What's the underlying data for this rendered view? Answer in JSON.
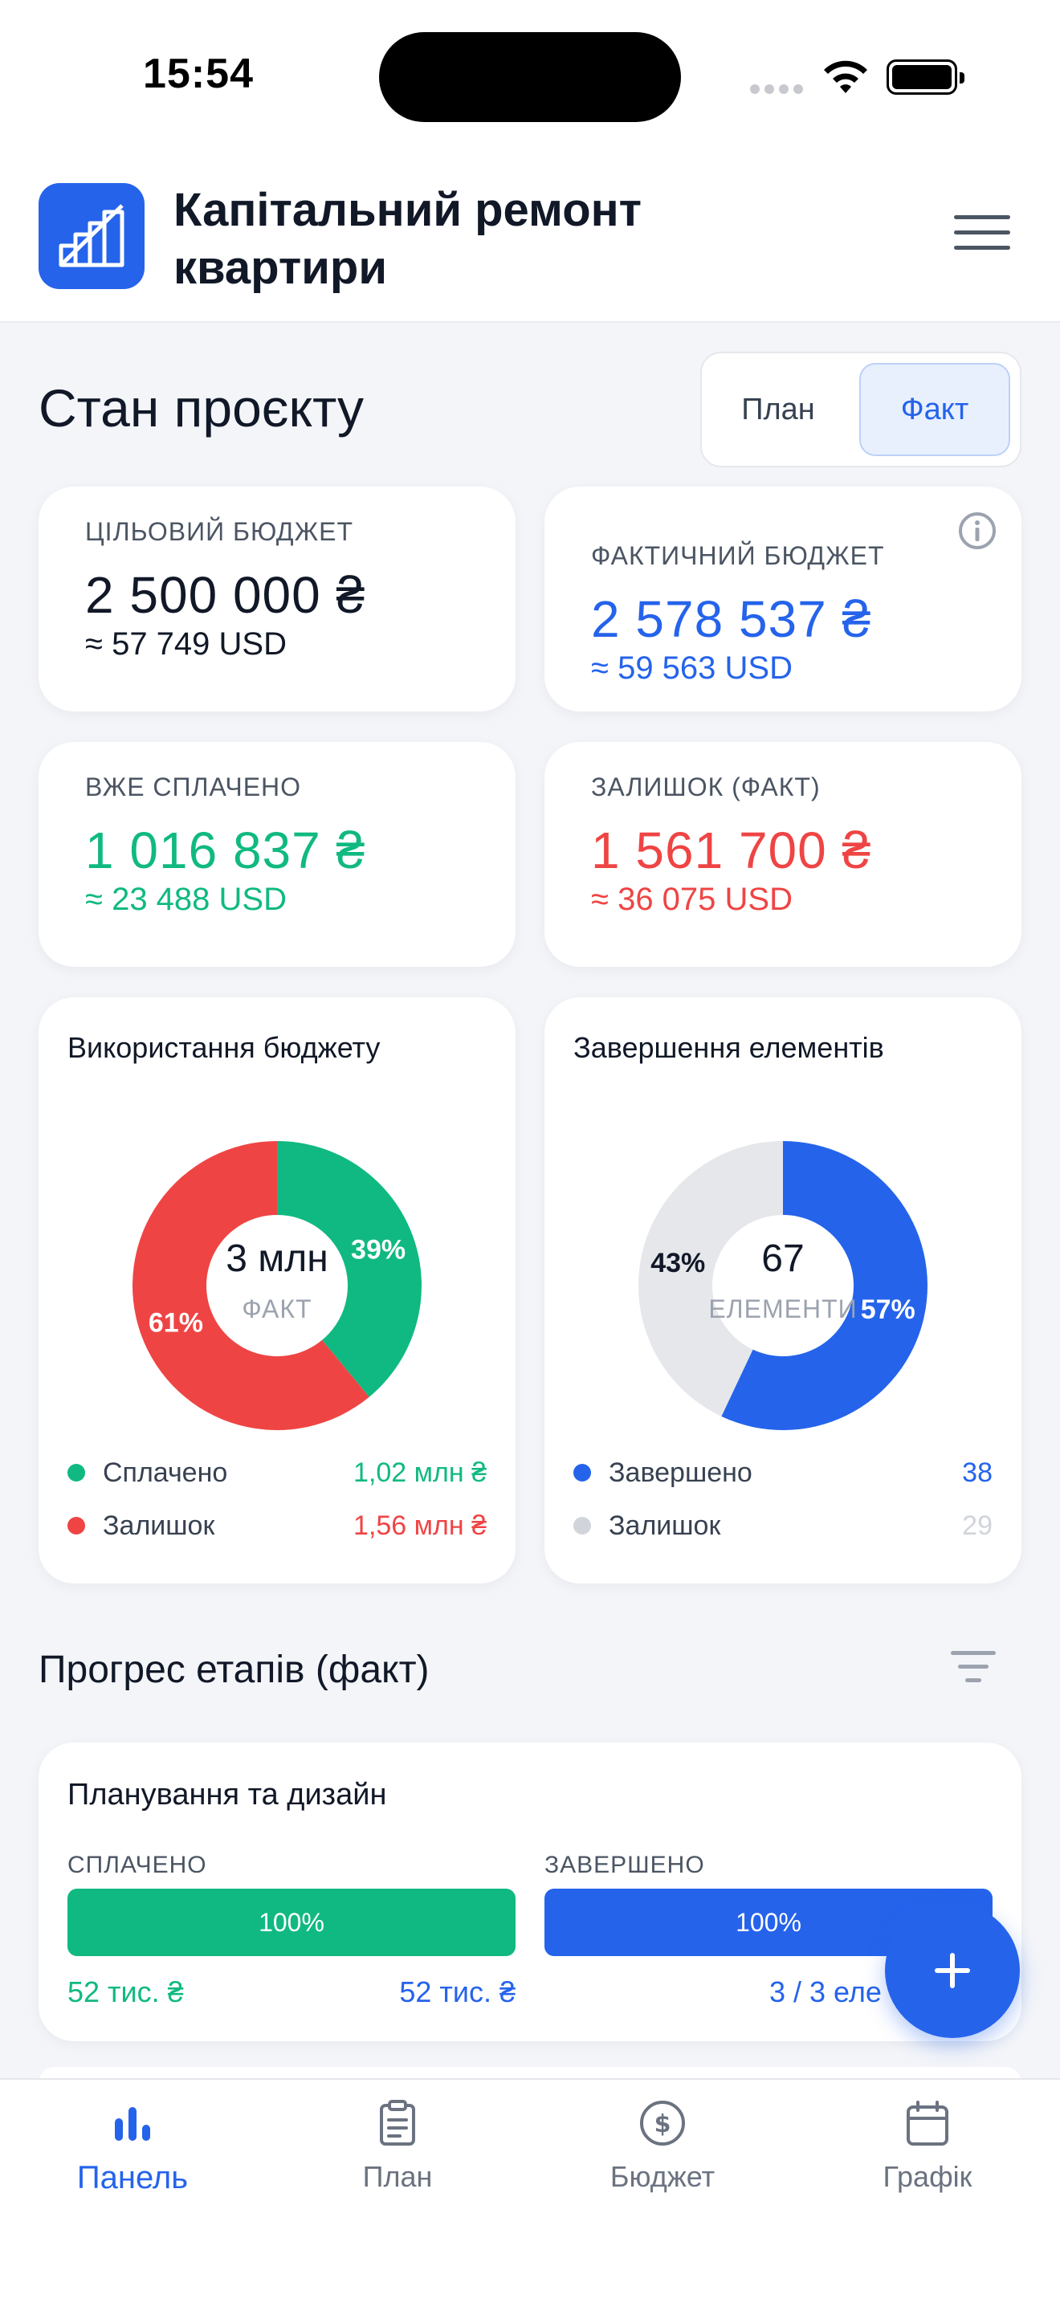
{
  "status_bar": {
    "time": "15:54"
  },
  "header": {
    "title": "Капітальний ремонт квартири",
    "logo_icon": "building-stairs-icon",
    "menu_icon": "hamburger-menu-icon"
  },
  "overview": {
    "title": "Стан проєкту",
    "toggle": {
      "plan": "План",
      "fact": "Факт",
      "selected": "Факт"
    }
  },
  "kpis": {
    "target": {
      "label": "ЦІЛЬОВИЙ БЮДЖЕТ",
      "value": "2 500 000 ₴",
      "usd": "≈ 57 749 USD",
      "color": "#111827"
    },
    "actual": {
      "label": "ФАКТИЧНИЙ БЮДЖЕТ",
      "value": "2 578 537 ₴",
      "usd": "≈ 59 563 USD",
      "color": "#2563eb"
    },
    "paid": {
      "label": "ВЖЕ СПЛАЧЕНО",
      "value": "1 016 837 ₴",
      "usd": "≈ 23 488 USD",
      "color": "#10b981"
    },
    "remaining": {
      "label": "ЗАЛИШОК (ФАКТ)",
      "value": "1 561 700 ₴",
      "usd": "≈ 36 075 USD",
      "color": "#ef4444"
    }
  },
  "budget_chart": {
    "title": "Використання бюджету",
    "center_value": "3 млн",
    "center_label": "ФАКТ",
    "legend": [
      {
        "label": "Сплачено",
        "value": "1,02 млн ₴",
        "color": "#10b981"
      },
      {
        "label": "Залишок",
        "value": "1,56 млн ₴",
        "color": "#ef4444"
      }
    ]
  },
  "elements_chart": {
    "title": "Завершення елементів",
    "center_value": "67",
    "center_label": "ЕЛЕМЕНТИ",
    "legend": [
      {
        "label": "Завершено",
        "value": "38",
        "color": "#2563eb"
      },
      {
        "label": "Залишок",
        "value": "29",
        "color": "#d1d5db"
      }
    ]
  },
  "chart_data": [
    {
      "type": "pie",
      "title": "Використання бюджету",
      "categories": [
        "Сплачено",
        "Залишок"
      ],
      "values": [
        39,
        61
      ],
      "labels": [
        "39%",
        "61%"
      ],
      "colors": [
        "#10b981",
        "#ef4444"
      ]
    },
    {
      "type": "pie",
      "title": "Завершення елементів",
      "categories": [
        "Завершено",
        "Залишок"
      ],
      "values": [
        57,
        43
      ],
      "labels": [
        "57%",
        "43%"
      ],
      "colors": [
        "#2563eb",
        "#e5e7eb"
      ]
    }
  ],
  "stages": {
    "title": "Прогрес етапів (факт)",
    "filter_icon": "filter-icon",
    "items": [
      {
        "name": "Планування та дизайн",
        "paid_label": "СПЛАЧЕНО",
        "paid_progress": 1.0,
        "paid_percent": "100%",
        "paid_amount": "52 тис. ₴",
        "paid_total": "52 тис. ₴",
        "done_label": "ЗАВЕРШЕНО",
        "done_progress": 1.0,
        "done_percent": "100%",
        "done_count": "3 / 3 еле"
      }
    ]
  },
  "fab": {
    "icon": "plus-icon"
  },
  "bottom_nav": {
    "items": [
      {
        "label": "Панель",
        "icon": "bar-chart-icon",
        "active": true
      },
      {
        "label": "План",
        "icon": "clipboard-icon",
        "active": false
      },
      {
        "label": "Бюджет",
        "icon": "dollar-circle-icon",
        "active": false
      },
      {
        "label": "Графік",
        "icon": "calendar-icon",
        "active": false
      }
    ]
  }
}
